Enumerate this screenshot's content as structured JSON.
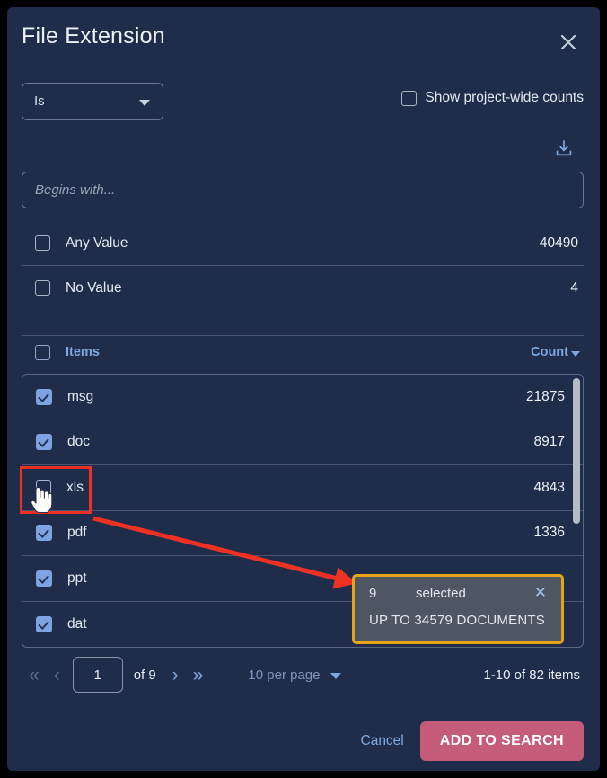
{
  "dialog": {
    "title": "File Extension",
    "close_icon": "close-icon"
  },
  "operator": {
    "selected": "Is",
    "caret_icon": "chevron-down-icon"
  },
  "project_wide": {
    "label": "Show project-wide counts",
    "checked": false
  },
  "download": {
    "icon": "download-icon"
  },
  "search": {
    "value": "",
    "placeholder": "Begins with..."
  },
  "special_rows": [
    {
      "label": "Any Value",
      "count": "40490",
      "checked": false
    },
    {
      "label": "No Value",
      "count": "4",
      "checked": false
    }
  ],
  "items_header": {
    "label": "Items",
    "checked": false,
    "sort_label": "Count",
    "sort_caret_icon": "caret-down-icon"
  },
  "items": [
    {
      "label": "msg",
      "count": "21875",
      "checked": true
    },
    {
      "label": "doc",
      "count": "8917",
      "checked": true
    },
    {
      "label": "xls",
      "count": "4843",
      "checked": false
    },
    {
      "label": "pdf",
      "count": "1336",
      "checked": true
    },
    {
      "label": "ppt",
      "count": "",
      "checked": true
    },
    {
      "label": "dat",
      "count": "",
      "checked": true
    }
  ],
  "pagination": {
    "first_icon": "«",
    "prev_icon": "‹",
    "next_icon": "›",
    "last_icon": "»",
    "page": "1",
    "of_label": "of 9",
    "per_page_label": "10 per page",
    "per_page_caret_icon": "caret-down-icon",
    "range_label": "1-10 of 82 items"
  },
  "footer": {
    "cancel_label": "Cancel",
    "add_label": "ADD TO SEARCH"
  },
  "tooltip": {
    "count": "9",
    "word": "selected",
    "close_icon": "✕",
    "detail": "UP TO 34579 DOCUMENTS"
  },
  "colors": {
    "dialog_bg": "#1f2d4a",
    "accent_blue": "#7fa8e0",
    "checkbox_blue": "#7ea3e0",
    "primary_button": "#c45c7a",
    "highlight_red": "#ef3124",
    "tooltip_border": "#e8a317",
    "tooltip_bg": "#4e5664"
  }
}
